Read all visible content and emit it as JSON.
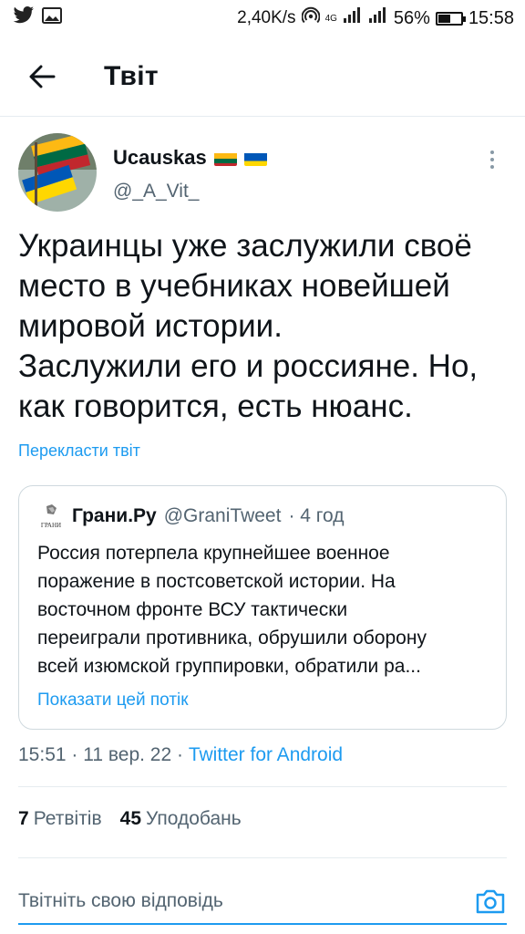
{
  "status_bar": {
    "network_speed": "2,40K/s",
    "signal_label": "4G",
    "battery_percent": "56%",
    "battery_level": 0.56,
    "time": "15:58"
  },
  "header": {
    "title": "Твіт"
  },
  "tweet": {
    "author_name": "Ucauskas",
    "author_handle": "@_A_Vit_",
    "text_lines": [
      "Украинцы уже заслужили своё",
      "место в учебниках новейшей",
      "мировой истории.",
      "Заслужили его и россияне. Но,",
      "как говорится, есть нюанс."
    ],
    "translate_label": "Перекласти твіт",
    "timestamp": "15:51 · 11 вер. 22 · ",
    "source": "Twitter for Android"
  },
  "quote": {
    "logo_text": "ГРАНИ",
    "name": "Грани.Ру",
    "handle": "@GraniTweet",
    "time": "· 4 год",
    "text_lines": [
      "Россия потерпела крупнейшее военное",
      "поражение в постсоветской истории. На",
      "восточном фронте ВСУ тактически",
      "переиграли противника, обрушили оборону",
      "всей изюмской группировки, обратили ра..."
    ],
    "show_thread_label": "Показати цей потік"
  },
  "stats": {
    "retweets_count": "7",
    "retweets_label": "Ретвітів",
    "likes_count": "45",
    "likes_label": "Уподобань"
  },
  "reply": {
    "placeholder": "Твітніть свою відповідь"
  },
  "colors": {
    "accent": "#1d9bf0",
    "secondary_text": "#536471"
  }
}
